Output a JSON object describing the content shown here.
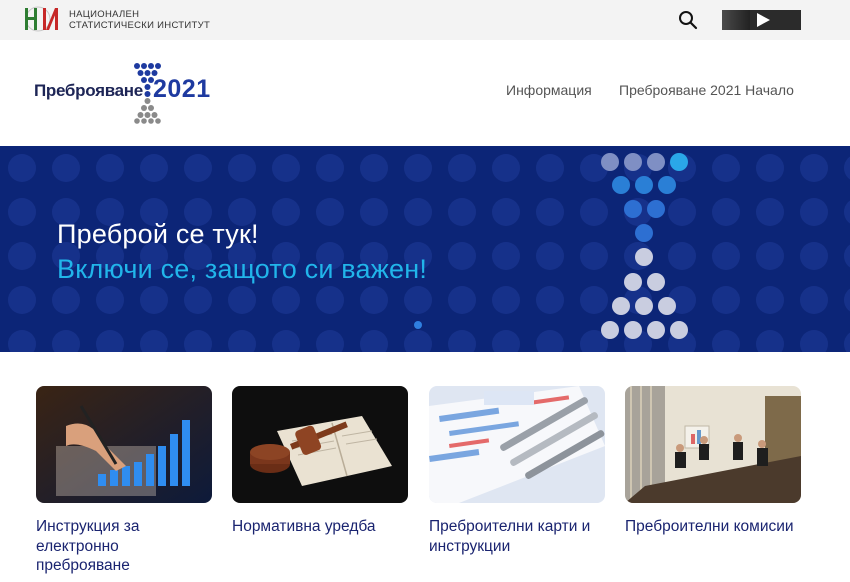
{
  "topbar": {
    "institute_line1": "НАЦИОНАЛЕН",
    "institute_line2": "СТАТИСТИЧЕСКИ ИНСТИТУТ",
    "logo_mark": "НСИ",
    "search_icon": "search-icon",
    "video_icon": "play-icon"
  },
  "header": {
    "logo_word": "Преброяване",
    "logo_year": "2021",
    "nav": [
      {
        "label": "Информация"
      },
      {
        "label": "Преброяване 2021 Начало"
      }
    ]
  },
  "hero": {
    "line1": "Преброй се тук!",
    "line2": "Включи се, защото си важен!",
    "slides_count": 1,
    "active_slide": 1
  },
  "cards": [
    {
      "title": "Инструкция за електронно преброяване",
      "image": "chart-bars-pen-photo"
    },
    {
      "title": "Нормативна уредба",
      "image": "gavel-book-photo"
    },
    {
      "title": "Преброителни карти и инструкции",
      "image": "census-forms-pens-photo"
    },
    {
      "title": "Преброителни комисии",
      "image": "meeting-room-photo"
    }
  ],
  "colors": {
    "hero_bg": "#0c2577",
    "hero_accent": "#21b5ea",
    "brand_blue": "#1e3aa0",
    "topbar_bg": "#f3f3f3"
  }
}
